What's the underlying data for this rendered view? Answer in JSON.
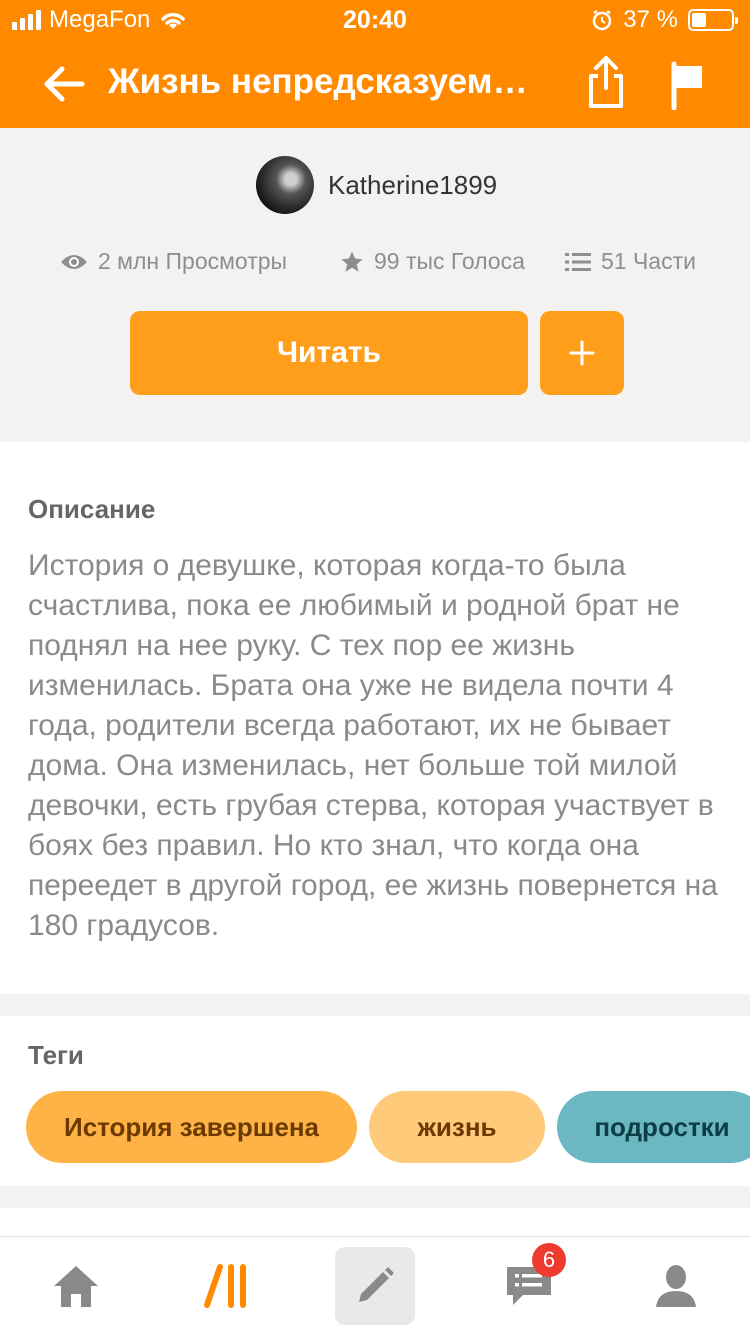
{
  "status_bar": {
    "carrier": "MegaFon",
    "time": "20:40",
    "battery_percent": "37 %",
    "battery_level": 0.37
  },
  "nav": {
    "title": "Жизнь непредсказуем…",
    "icons": [
      "back-arrow-icon",
      "share-icon",
      "flag-icon"
    ]
  },
  "story": {
    "author": "Katherine1899",
    "views": "2 млн Просмотры",
    "votes": "99 тыс Голоса",
    "parts": "51 Части",
    "read_label": "Читать",
    "add_label": "+"
  },
  "description": {
    "heading": "Описание",
    "text": "История о девушке, которая когда-то была счастлива, пока ее любимый и родной брат не поднял на нее руку. С тех пор ее жизнь изменилась. Брата она уже не видела почти 4 года, родители всегда работают, их не бывает дома. Она изменилась, нет больше той милой девочки, есть грубая стерва, которая участвует в боях без правил. Но кто знал, что когда она переедет в другой город, ее жизнь повернется на 180 градусов."
  },
  "tags": {
    "heading": "Теги",
    "items": [
      {
        "label": "История завершена",
        "color": "#ffb347",
        "text_color": "#6b3a00"
      },
      {
        "label": "жизнь",
        "color": "#ffca7a",
        "text_color": "#6b3a00"
      },
      {
        "label": "подростки",
        "color": "#6bb7c2",
        "text_color": "#0d3d45"
      }
    ]
  },
  "tabbar": {
    "items": [
      "home-icon",
      "library-icon",
      "write-icon",
      "messages-icon",
      "profile-icon"
    ],
    "messages_badge": "6"
  },
  "colors": {
    "brand_orange": "#ff8a00",
    "button_orange": "#ff9e1a",
    "badge_red": "#ef3b2d"
  }
}
